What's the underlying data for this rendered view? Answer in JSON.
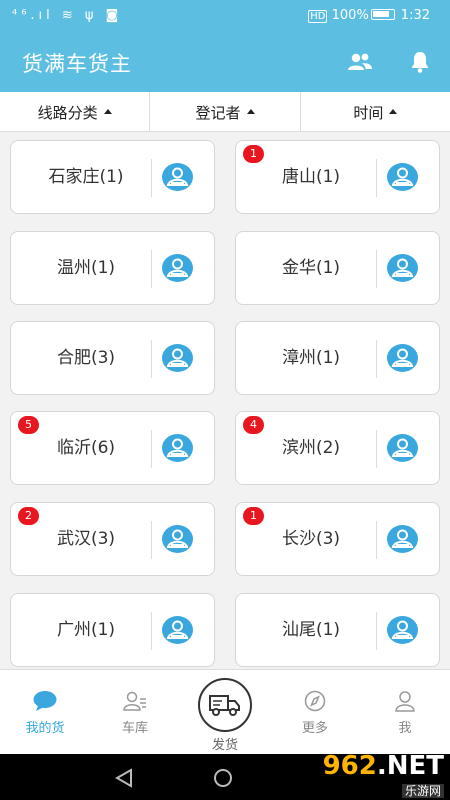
{
  "status_bar": {
    "left": "⁴⁶.ıl  ≋  ψ  ◙",
    "hd": "HD",
    "battery": "100%",
    "time": "1:32"
  },
  "app_bar": {
    "title": "货满车货主"
  },
  "filters": [
    {
      "label": "线路分类"
    },
    {
      "label": "登记者"
    },
    {
      "label": "时间"
    }
  ],
  "cards": [
    {
      "name": "石家庄(1)",
      "badge": ""
    },
    {
      "name": "唐山(1)",
      "badge": "1"
    },
    {
      "name": "温州(1)",
      "badge": ""
    },
    {
      "name": "金华(1)",
      "badge": ""
    },
    {
      "name": "合肥(3)",
      "badge": ""
    },
    {
      "name": "漳州(1)",
      "badge": ""
    },
    {
      "name": "临沂(6)",
      "badge": "5"
    },
    {
      "name": "滨州(2)",
      "badge": "4"
    },
    {
      "name": "武汉(3)",
      "badge": "2"
    },
    {
      "name": "长沙(3)",
      "badge": "1"
    },
    {
      "name": "广州(1)",
      "badge": ""
    },
    {
      "name": "汕尾(1)",
      "badge": ""
    }
  ],
  "bottom_nav": {
    "items": [
      {
        "label": "我的货",
        "icon": "chat-bubble-icon"
      },
      {
        "label": "车库",
        "icon": "garage-user-icon"
      },
      {
        "label": "发货",
        "icon": "truck-icon"
      },
      {
        "label": "更多",
        "icon": "compass-icon"
      },
      {
        "label": "我",
        "icon": "person-icon"
      }
    ]
  },
  "watermark": {
    "brand_num": "962",
    "brand_net": ".NET",
    "sub": "乐游网"
  },
  "colors": {
    "primary": "#5cbfe2",
    "accent_icon": "#3aa8de",
    "badge": "#e8161e"
  }
}
